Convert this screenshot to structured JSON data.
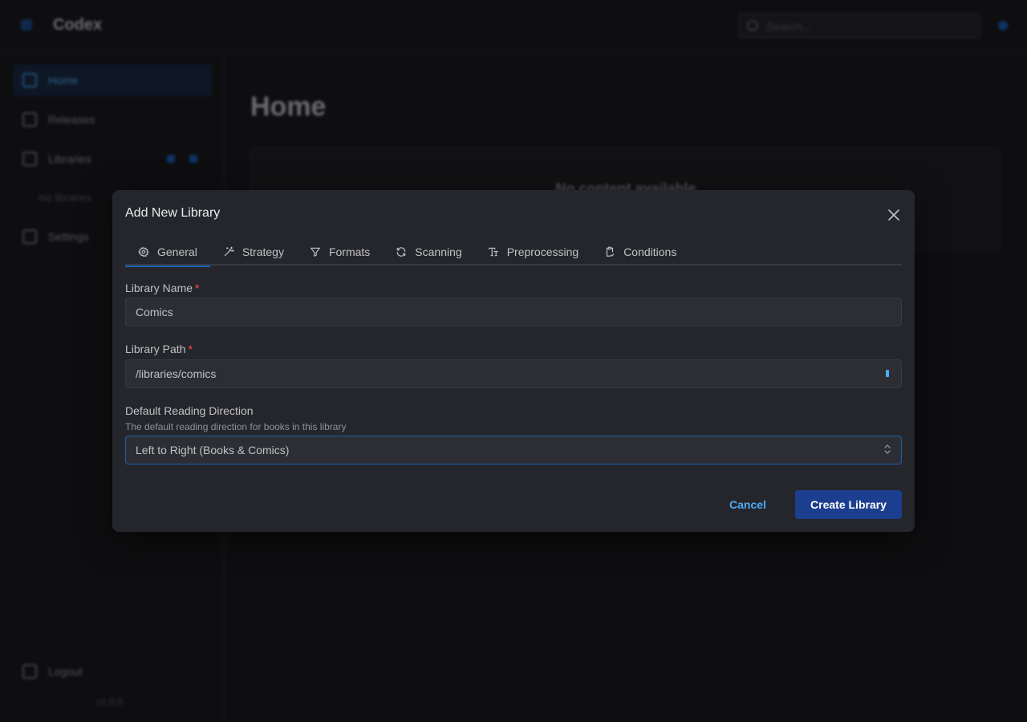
{
  "app": {
    "title": "Codex",
    "search_placeholder": "Search...",
    "version": "v1.0.0"
  },
  "sidebar": {
    "items": [
      {
        "label": "Home"
      },
      {
        "label": "Releases"
      },
      {
        "label": "Libraries"
      },
      {
        "label": "Settings"
      }
    ],
    "libraries_empty": "No libraries",
    "logout": "Logout"
  },
  "main": {
    "title": "Home",
    "empty_text": "No content available"
  },
  "modal": {
    "title": "Add New Library",
    "tabs": [
      {
        "label": "General",
        "icon": "gear-icon"
      },
      {
        "label": "Strategy",
        "icon": "wand-icon"
      },
      {
        "label": "Formats",
        "icon": "filter-icon"
      },
      {
        "label": "Scanning",
        "icon": "refresh-icon"
      },
      {
        "label": "Preprocessing",
        "icon": "text-size-icon"
      },
      {
        "label": "Conditions",
        "icon": "clipboard-check-icon"
      }
    ],
    "fields": {
      "name": {
        "label": "Library Name",
        "required": "*",
        "value": "Comics"
      },
      "path": {
        "label": "Library Path",
        "required": "*",
        "value": "/libraries/comics"
      },
      "direction": {
        "label": "Default Reading Direction",
        "description": "The default reading direction for books in this library",
        "value": "Left to Right (Books & Comics)"
      }
    },
    "cancel_label": "Cancel",
    "create_label": "Create Library"
  },
  "colors": {
    "accent": "#1c3e8f",
    "link": "#4dabf7",
    "required": "#fa5252"
  }
}
